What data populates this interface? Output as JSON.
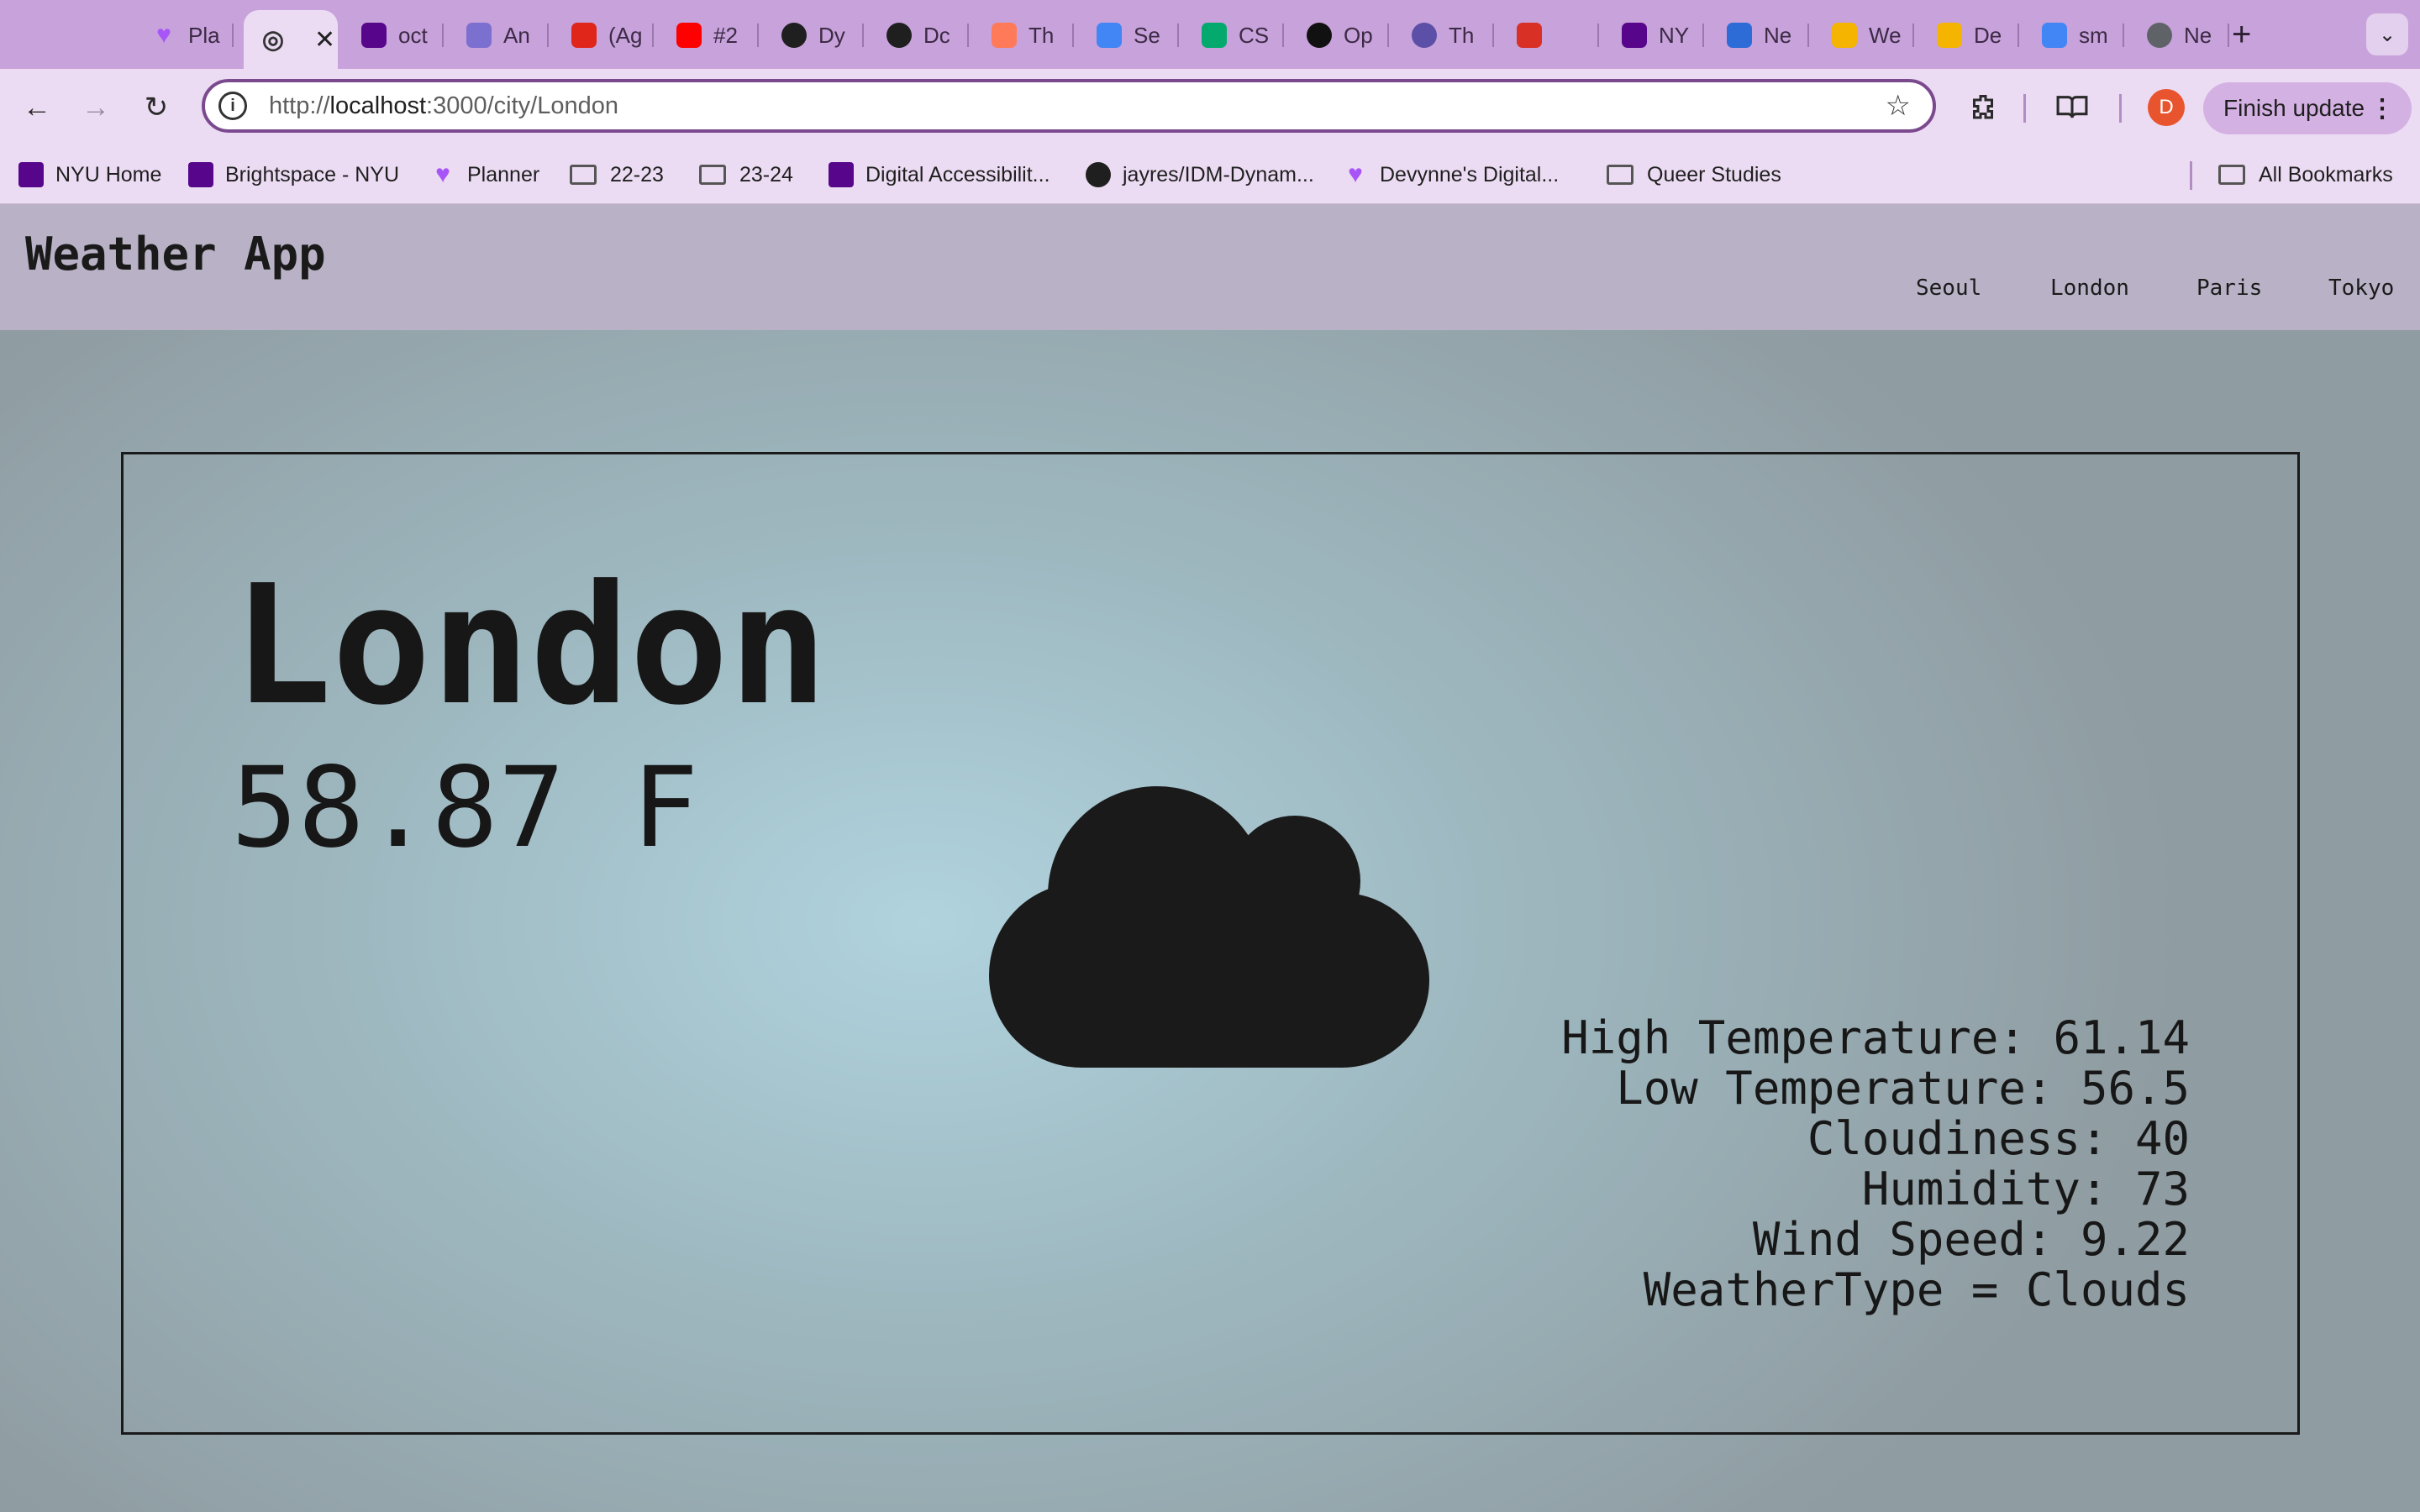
{
  "browser": {
    "tabs": [
      {
        "label": "Pla",
        "icon": "heart-icon",
        "color": "#a855f7"
      },
      {
        "label": "",
        "icon": "globe-icon",
        "active": true
      },
      {
        "label": "oct",
        "icon": "nyu-torch-icon",
        "color": "#57068c"
      },
      {
        "label": "An",
        "icon": "triangle-icon",
        "color": "#7b6fd0"
      },
      {
        "label": "(Ag",
        "icon": "acrobat-icon",
        "color": "#e0251b"
      },
      {
        "label": "#2",
        "icon": "youtube-icon",
        "color": "#ff0000"
      },
      {
        "label": "Dy",
        "icon": "github-icon",
        "color": "#1f1f1f"
      },
      {
        "label": "Dc",
        "icon": "github-icon",
        "color": "#1f1f1f"
      },
      {
        "label": "Th",
        "icon": "hubspot-icon",
        "color": "#ff7a59"
      },
      {
        "label": "Se",
        "icon": "colorful-grid-icon",
        "color": "#4285f4"
      },
      {
        "label": "CS",
        "icon": "w3-icon",
        "color": "#04aa6d"
      },
      {
        "label": "Op",
        "icon": "notion-icon",
        "color": "#111111"
      },
      {
        "label": "Th",
        "icon": "arc-icon",
        "color": "#5b4fa8"
      },
      {
        "label": "",
        "icon": "gmail-icon",
        "color": "#d93025"
      },
      {
        "label": "NY",
        "icon": "nyu-torch-icon",
        "color": "#57068c"
      },
      {
        "label": "Ne",
        "icon": "b-icon",
        "color": "#2d6bd6"
      },
      {
        "label": "We",
        "icon": "slides-icon",
        "color": "#f4b400"
      },
      {
        "label": "De",
        "icon": "slides-icon",
        "color": "#f4b400"
      },
      {
        "label": "sm",
        "icon": "google-icon",
        "color": "#4285f4"
      },
      {
        "label": "Ne",
        "icon": "chrome-icon",
        "color": "#5f6368"
      }
    ],
    "url_prefix": "http://",
    "url_host": "localhost",
    "url_path": ":3000/city/London",
    "avatar_letter": "D",
    "finish_update_label": "Finish update",
    "bookmarks": [
      {
        "label": "NYU Home",
        "icon": "nyu-torch-icon"
      },
      {
        "label": "Brightspace - NYU",
        "icon": "nyu-torch-icon"
      },
      {
        "label": "Planner",
        "icon": "heart-icon"
      },
      {
        "label": "22-23",
        "icon": "folder-icon"
      },
      {
        "label": "23-24",
        "icon": "folder-icon"
      },
      {
        "label": "Digital Accessibilit...",
        "icon": "nyu-icon"
      },
      {
        "label": "jayres/IDM-Dynam...",
        "icon": "github-icon"
      },
      {
        "label": "Devynne's Digital...",
        "icon": "heart-icon"
      },
      {
        "label": "Queer Studies",
        "icon": "folder-icon"
      }
    ],
    "all_bookmarks_label": "All Bookmarks"
  },
  "app": {
    "brand": "Weather App",
    "nav": [
      "Seoul",
      "London",
      "Paris",
      "Tokyo"
    ],
    "city": "London",
    "temperature": "58.87 F",
    "weather_icon": "cloud-icon",
    "details": {
      "high": "High Temperature: 61.14",
      "low": "Low Temperature: 56.5",
      "cloudiness": "Cloudiness: 40",
      "humidity": "Humidity: 73",
      "wind": "Wind Speed: 9.22",
      "type": "WeatherType = Clouds"
    }
  }
}
